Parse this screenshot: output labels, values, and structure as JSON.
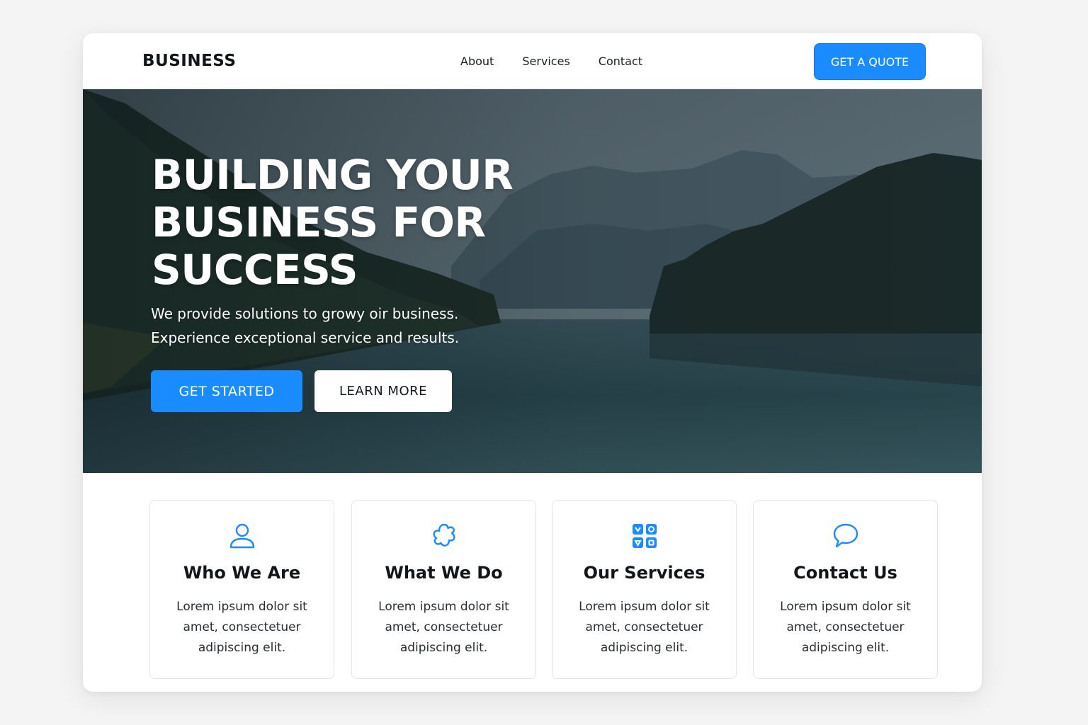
{
  "brand": {
    "logo": "BUSINESS",
    "accent": "#1a8cff"
  },
  "nav": {
    "links": [
      "About",
      "Services",
      "Contact"
    ],
    "cta": "GET A QUOTE"
  },
  "hero": {
    "title_lines": [
      "BUILDING YOUR",
      "BUSINESS FOR",
      "SUCCESS"
    ],
    "subtitle_lines": [
      "We provide solutions to growy oir business.",
      "Experience exceptional service and results."
    ],
    "primary_button": "GET STARTED",
    "secondary_button": "LEARN MORE"
  },
  "cards": [
    {
      "icon": "user-icon",
      "title": "Who We Are",
      "text_lines": [
        "Lorem ipsum dolor sit",
        "amet, consectetuer",
        "adipiscing elit."
      ]
    },
    {
      "icon": "gear-flower-icon",
      "title": "What We Do",
      "text_lines": [
        "Lorem ipsum dolor sit",
        "amet, consectetuer",
        "adipiscing elit."
      ]
    },
    {
      "icon": "services-grid-icon",
      "title": "Our Services",
      "text_lines": [
        "Lorem ipsum dolor sit",
        "amet, consectetuer",
        "adipiscing elit."
      ]
    },
    {
      "icon": "chat-bubble-icon",
      "title": "Contact Us",
      "text_lines": [
        "Lorem ipsum dolor sit",
        "amet, consectetuer",
        "adipiscing elit."
      ]
    }
  ]
}
